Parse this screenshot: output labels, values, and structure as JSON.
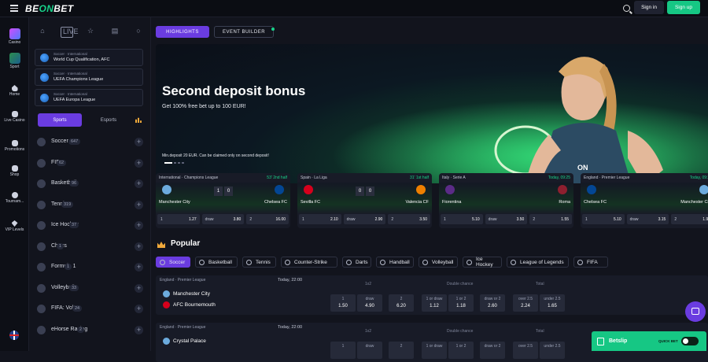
{
  "header": {
    "logo_a": "BE",
    "logo_b": "ON",
    "logo_c": "BET",
    "signin": "Sign in",
    "signup": "Sign up"
  },
  "rail": [
    {
      "label": "Casino"
    },
    {
      "label": "Sport"
    },
    {
      "label": "Home"
    },
    {
      "label": "Live Casino"
    },
    {
      "label": "Promotions"
    },
    {
      "label": "Shop"
    },
    {
      "label": "Tournam..."
    },
    {
      "label": "VIP Levels"
    }
  ],
  "sidebar": {
    "live": "LIVE",
    "leagues": [
      {
        "cat": "Soccer · International",
        "name": "World Cup Qualification, AFC"
      },
      {
        "cat": "Soccer · International",
        "name": "UEFA Champions League"
      },
      {
        "cat": "Soccer · International",
        "name": "UEFA Europa League"
      }
    ],
    "tab_sports": "Sports",
    "tab_esports": "Esports",
    "sports": [
      {
        "name": "Soccer",
        "count": "647"
      },
      {
        "name": "FIFA",
        "count": "62"
      },
      {
        "name": "Basketball",
        "count": "96"
      },
      {
        "name": "Tennis",
        "count": "319"
      },
      {
        "name": "Ice Hockey",
        "count": "37"
      },
      {
        "name": "Chess",
        "count": "1"
      },
      {
        "name": "Formula 1",
        "count": "1"
      },
      {
        "name": "Volleyball",
        "count": "33"
      },
      {
        "name": "FIFA: Volta",
        "count": "24"
      },
      {
        "name": "eHorse Racing",
        "count": "2"
      }
    ]
  },
  "main": {
    "tab_highlights": "HIGHLIGHTS",
    "tab_event_builder": "EVENT BUILDER",
    "banner": {
      "title": "Second deposit bonus",
      "subtitle": "Get 100% free bet up to 100 EUR!",
      "note": "Min.deposit 20 EUR. Can be claimed only on second deposit!"
    },
    "cards": [
      {
        "league": "International · Champions League",
        "time": "53' 2nd half",
        "home": "Manchester City",
        "away": "Chelsea FC",
        "s1": "1",
        "s2": "0",
        "o1l": "1",
        "o1": "1.27",
        "oxl": "draw",
        "ox": "3.80",
        "o2l": "2",
        "o2": "16.00"
      },
      {
        "league": "Spain · La Liga",
        "time": "31' 1st half",
        "home": "Sevilla FC",
        "away": "Valencia CF",
        "s1": "0",
        "s2": "0",
        "o1l": "1",
        "o1": "2.10",
        "oxl": "draw",
        "ox": "2.90",
        "o2l": "2",
        "o2": "3.50"
      },
      {
        "league": "Italy · Serie A",
        "time": "Today, 09:25",
        "home": "Fiorentina",
        "away": "Roma",
        "s1": "",
        "s2": "",
        "o1l": "1",
        "o1": "5.10",
        "oxl": "draw",
        "ox": "3.50",
        "o2l": "2",
        "o2": "1.55"
      },
      {
        "league": "England · Premier League",
        "time": "Today, 09:25",
        "home": "Chelsea FC",
        "away": "Manchester City",
        "s1": "",
        "s2": "",
        "o1l": "1",
        "o1": "5.10",
        "oxl": "draw",
        "ox": "3.15",
        "o2l": "2",
        "o2": "1.95"
      }
    ],
    "popular_title": "Popular",
    "chips": [
      "Soccer",
      "Basketball",
      "Tennis",
      "Counter-Strike",
      "Darts",
      "Handball",
      "Volleyball",
      "Ice Hockey",
      "League of Legends",
      "FIFA"
    ],
    "matches": [
      {
        "league": "England · Premier League",
        "time": "Today, 22:00",
        "home": "Manchester City",
        "away": "AFC Bournemouth",
        "g1": "1x2",
        "g2": "Double chance",
        "g3": "Total",
        "odds": [
          {
            "l": "1",
            "v": "1.50"
          },
          {
            "l": "draw",
            "v": "4.90"
          },
          {
            "l": "2",
            "v": "6.20"
          },
          {
            "l": "1 or draw",
            "v": "1.12"
          },
          {
            "l": "1 or 2",
            "v": "1.18"
          },
          {
            "l": "draw or 2",
            "v": "2.60"
          },
          {
            "l": "over 2.5",
            "v": "2.24"
          },
          {
            "l": "under 2.5",
            "v": "1.65"
          }
        ]
      },
      {
        "league": "England · Premier League",
        "time": "Today, 22:00",
        "home": "Crystal Palace",
        "away": "",
        "g1": "1x2",
        "g2": "Double chance",
        "g3": "Total",
        "odds": [
          {
            "l": "1",
            "v": ""
          },
          {
            "l": "draw",
            "v": ""
          },
          {
            "l": "2",
            "v": ""
          },
          {
            "l": "1 or draw",
            "v": ""
          },
          {
            "l": "1 or 2",
            "v": ""
          },
          {
            "l": "draw or 2",
            "v": ""
          },
          {
            "l": "over 2.5",
            "v": ""
          },
          {
            "l": "under 2.5",
            "v": ""
          }
        ]
      }
    ]
  },
  "betslip": {
    "label": "Betslip",
    "quick_bet": "QUICK BET"
  },
  "colors": {
    "accent": "#6a3ce0",
    "green": "#16c784",
    "bg": "#12141d"
  }
}
